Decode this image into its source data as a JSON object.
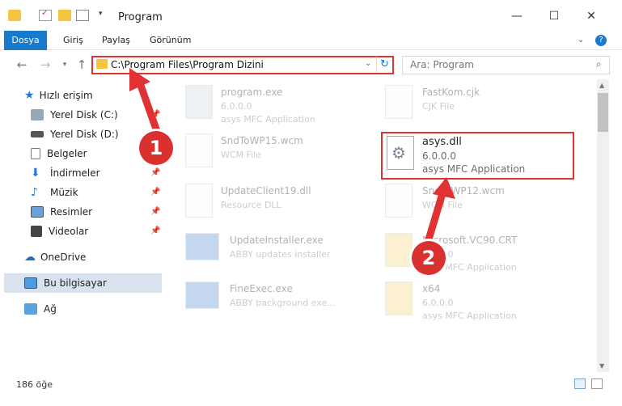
{
  "window": {
    "title": "Program",
    "minimize_glyph": "—",
    "maximize_glyph": "☐",
    "close_glyph": "✕"
  },
  "ribbon": {
    "tabs": [
      "Dosya",
      "Giriş",
      "Paylaş",
      "Görünüm"
    ]
  },
  "address": {
    "path": "C:\\Program Files\\Program Dizini",
    "search_placeholder": "Ara: Program"
  },
  "sidebar": {
    "quick_access": "Hızlı erişim",
    "items": [
      "Yerel Disk (C:)",
      "Yerel Disk (D:)",
      "Belgeler",
      "İndirmeler",
      "Müzik",
      "Resimler",
      "Videolar"
    ],
    "onedrive": "OneDrive",
    "this_pc": "Bu bilgisayar",
    "network": "Ağ"
  },
  "files": {
    "left": [
      {
        "name": "program.exe",
        "l1": "6.0.0.0",
        "l2": "asys MFC Application"
      },
      {
        "name": "SndToWP15.wcm",
        "l1": "WCM File",
        "l2": ""
      },
      {
        "name": "UpdateClient19.dll",
        "l1": "Resource DLL",
        "l2": ""
      },
      {
        "name": "UpdateInstaller.exe",
        "l1": "ABBY updates installer",
        "l2": ""
      },
      {
        "name": "FineExec.exe",
        "l1": "ABBY background exe...",
        "l2": ""
      }
    ],
    "right": [
      {
        "name": "FastKom.cjk",
        "l1": "CJK File",
        "l2": ""
      },
      {
        "name": "asys.dll",
        "l1": "6.0.0.0",
        "l2": "asys MFC Application"
      },
      {
        "name": "SndToWP12.wcm",
        "l1": "WCM File",
        "l2": ""
      },
      {
        "name": "Microsoft.VC90.CRT",
        "l1": "6.0.0.0",
        "l2": "asys MFC Application"
      },
      {
        "name": "x64",
        "l1": "6.0.0.0",
        "l2": "asys MFC Application"
      }
    ]
  },
  "status": {
    "count": "186 öğe"
  },
  "annotations": {
    "badge1": "1",
    "badge2": "2"
  },
  "colors": {
    "accent": "#1979ca",
    "highlight": "#e03232"
  }
}
